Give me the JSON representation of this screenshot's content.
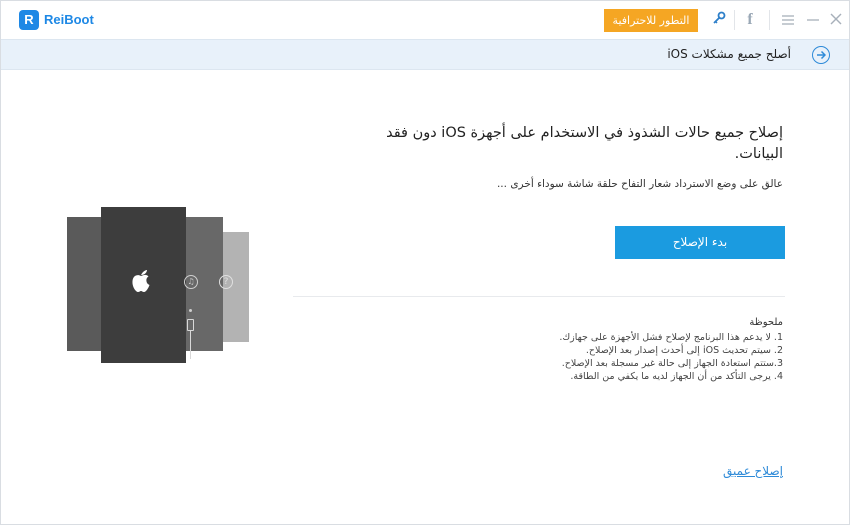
{
  "app": {
    "logo_letter": "R",
    "name": "ReiBoot",
    "upgrade_label": "التطور للاحترافية"
  },
  "titlebar_icons": {
    "key": "key-icon",
    "facebook": "facebook-icon",
    "menu": "menu-icon",
    "minimize": "minimize-icon",
    "close": "close-icon"
  },
  "subheader": {
    "title": "أصلح جميع مشكلات iOS"
  },
  "main": {
    "headline": "إصلاح جميع حالات الشذوذ في الاستخدام على أجهزة iOS دون فقد البيانات.",
    "subtext": "عالق على وضع الاسترداد شعار التفاح حلقة شاشة سوداء أخرى ...",
    "start_button": "بدء الإصلاح",
    "notes_title": "ملحوظة",
    "notes": [
      "1. لا يدعم هذا البرنامج لإصلاح فشل الأجهزة على جهازك.",
      "2. سيتم تحديث iOS إلى أحدث إصدار بعد الإصلاح.",
      "3.ستتم استعادة الجهاز إلى حالة غير مسجلة بعد الإصلاح.",
      "4. يرجى التأكد من أن الجهاز لديه ما يكفي من الطاقة."
    ],
    "deep_repair_link": "إصلاح عميق"
  },
  "colors": {
    "brand": "#1e88e5",
    "upgrade": "#f5a623",
    "primary_button": "#1b9be0",
    "subheader_bg": "#e8f1fa",
    "link": "#2d8ad8"
  }
}
